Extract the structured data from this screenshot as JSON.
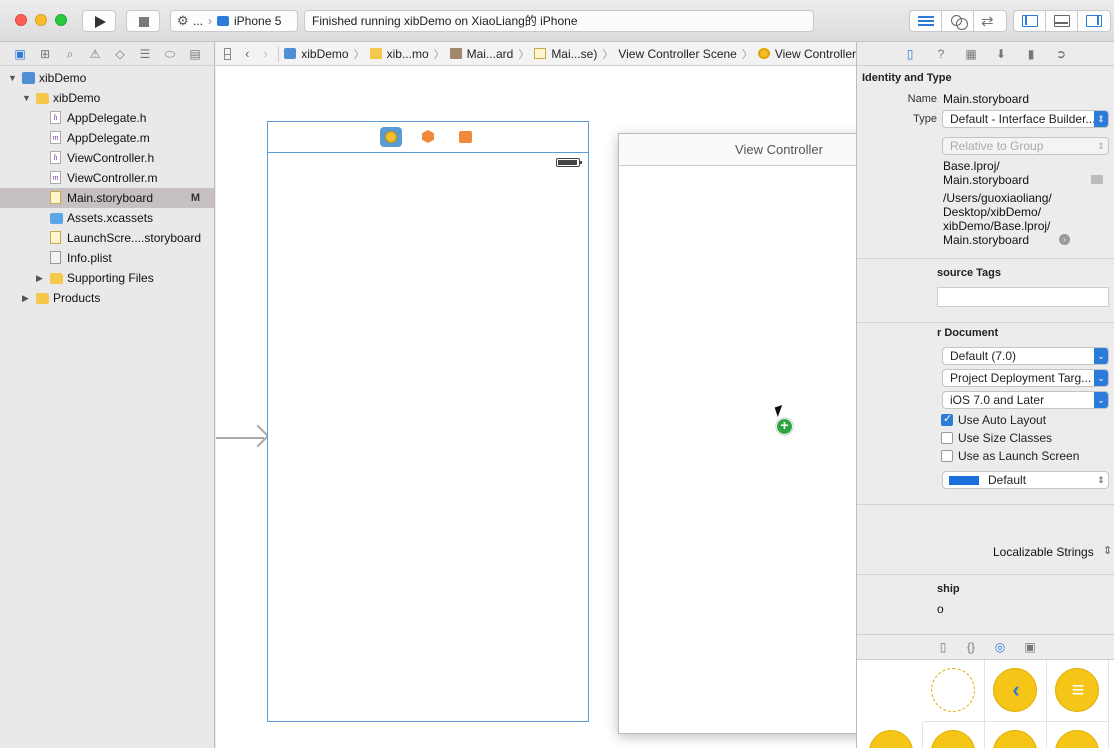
{
  "toolbar": {
    "scheme_app": "...",
    "scheme_device": "iPhone 5",
    "activity_status": "Finished running xibDemo on XiaoLiang的 iPhone"
  },
  "navigator": {
    "items": [
      {
        "label": "xibDemo",
        "type": "project",
        "indent": 0,
        "expanded": true
      },
      {
        "label": "xibDemo",
        "type": "folder",
        "indent": 1,
        "expanded": true
      },
      {
        "label": "AppDelegate.h",
        "type": "h",
        "indent": 2
      },
      {
        "label": "AppDelegate.m",
        "type": "m",
        "indent": 2
      },
      {
        "label": "ViewController.h",
        "type": "h",
        "indent": 2
      },
      {
        "label": "ViewController.m",
        "type": "m",
        "indent": 2
      },
      {
        "label": "Main.storyboard",
        "type": "storyboard",
        "indent": 2,
        "selected": true,
        "badge": "M"
      },
      {
        "label": "Assets.xcassets",
        "type": "assets",
        "indent": 2
      },
      {
        "label": "LaunchScre....storyboard",
        "type": "storyboard",
        "indent": 2
      },
      {
        "label": "Info.plist",
        "type": "plist",
        "indent": 2
      },
      {
        "label": "Supporting Files",
        "type": "folder",
        "indent": 2,
        "expanded": false
      },
      {
        "label": "Products",
        "type": "folder",
        "indent": 1,
        "expanded": false
      }
    ]
  },
  "jumpbar": {
    "crumbs": [
      "xibDemo",
      "xib...mo",
      "Mai...ard",
      "Mai...se)",
      "View Controller Scene",
      "View Controller"
    ]
  },
  "canvas": {
    "dragged_scene_title": "View Controller"
  },
  "inspector": {
    "identity_header": "Identity and Type",
    "name_label": "Name",
    "name_value": "Main.storyboard",
    "type_label": "Type",
    "type_value": "Default - Interface Builder...",
    "location_value": "Relative to Group",
    "path_short": "Base.lproj/\nMain.storyboard",
    "full_path": "/Users/guoxiaoliang/\nDesktop/xibDemo/\nxibDemo/Base.lproj/\nMain.storyboard",
    "resource_tags_header": "source Tags",
    "builder_doc_header": "r Document",
    "opens_in": "Default (7.0)",
    "builds_for": "Project Deployment Targ...",
    "view_as": "iOS 7.0 and Later",
    "use_auto_layout": {
      "label": "Use Auto Layout",
      "checked": true
    },
    "use_size_classes": {
      "label": "Use Size Classes",
      "checked": false
    },
    "use_launch_screen": {
      "label": "Use as Launch Screen",
      "checked": false
    },
    "global_tint": "Default",
    "global_tint_color": "#1a6fdd",
    "localization": "Localizable Strings",
    "membership_header": "ship",
    "membership_partial": "o"
  }
}
